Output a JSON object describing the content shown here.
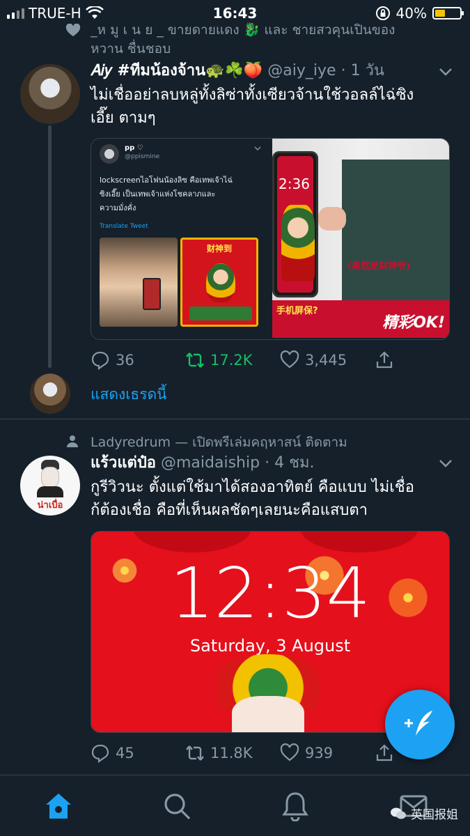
{
  "status_bar": {
    "carrier": "TRUE-H",
    "time": "16:43",
    "battery_percent": 40,
    "battery_label": "40%"
  },
  "liked_context": {
    "line1": "_ห มู เ น ย _ ขายดายแดง 🐉 และ ชายสวคุนเปินของ",
    "line2": "หวาน ชื่นชอบ"
  },
  "tweet1": {
    "name": "𝐴𝑖𝑦 #ทีมน้องจ้าน🐢☘️🍑",
    "handle": "@aiy_iye",
    "time": "1 วัน",
    "text_line1": "ไม่เชื่ออย่าลบหลู่ทั้งลิซ่าทั้งเซียวจ้านใช้วอลล์ไฉ่ซิง",
    "text_line2": "เอี๊ย ตามๆ",
    "embed": {
      "user_name": "pp ♡",
      "user_handle": "@ppismine",
      "text_line1": "lockscreenไอโฟนน้องลิซ คือเทพเจ้าไฉ่",
      "text_line2": "ซิงเอี๊ย เป็นเทพเจ้าแห่งโชคลาภและ",
      "text_line3": "ความมั่งคั่ง",
      "translate": "Translate Tweet",
      "poster_text": "财神到",
      "right_time": "2:36",
      "right_caption": "(果然是财神爷)",
      "right_question": "手机屏保?",
      "right_logo": "精彩OK!"
    },
    "replies": "36",
    "retweets": "17.2K",
    "likes": "3,445"
  },
  "show_thread": "แสดงเธรดนี้",
  "tweet2": {
    "follow_context": "Ladyredrum — เปิดพรีเล่มคฤหาสน์ ติดตาม",
    "name": "แร้วแต่ป๋อ",
    "handle": "@maidaiship",
    "time": "4 ชม.",
    "avatar_label": "น่าเบื่อ",
    "text_line1": "กูรีวิวนะ ตั้งแต่ใช้มาได้สองอาทิตย์ คือแบบ ไม่เชื่อ",
    "text_line2": "ก้ต้องเชื่อ คือที่เห็นผลชัดๆเลยนะคือแสบตา",
    "lock_time": "12:34",
    "lock_date": "Saturday, 3 August",
    "replies": "45",
    "retweets": "11.8K",
    "likes": "939"
  },
  "watermark": "英国报姐",
  "colors": {
    "background": "#15202b",
    "accent": "#1da1f2",
    "muted": "#8899a6",
    "retweet_green": "#17bf63"
  },
  "icons": {
    "tab_home": "home-icon",
    "tab_search": "search-icon",
    "tab_notifications": "bell-icon",
    "tab_messages": "mail-icon",
    "fab": "compose-tweet-icon"
  }
}
